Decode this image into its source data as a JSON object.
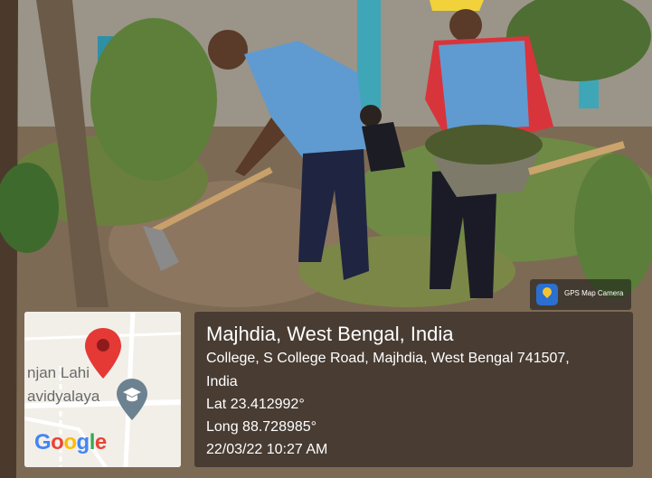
{
  "camera_badge": {
    "label": "GPS Map Camera",
    "icon": "gps-map-camera-icon"
  },
  "map": {
    "place_lines": [
      "njan Lahi",
      "avidyalaya"
    ],
    "logo_text": "Google",
    "logo_colors": [
      "#4285F4",
      "#EA4335",
      "#FBBC05",
      "#4285F4",
      "#34A853",
      "#EA4335"
    ],
    "pin_color": "#e53935",
    "school_icon": "graduation-cap-icon"
  },
  "location": {
    "title": "Majhdia, West Bengal, India",
    "address_line1": "College, S College Road, Majhdia, West Bengal 741507,",
    "address_line2": "India",
    "lat": "Lat 23.412992°",
    "long": "Long 88.728985°",
    "datetime": "22/03/22 10:27 AM"
  }
}
